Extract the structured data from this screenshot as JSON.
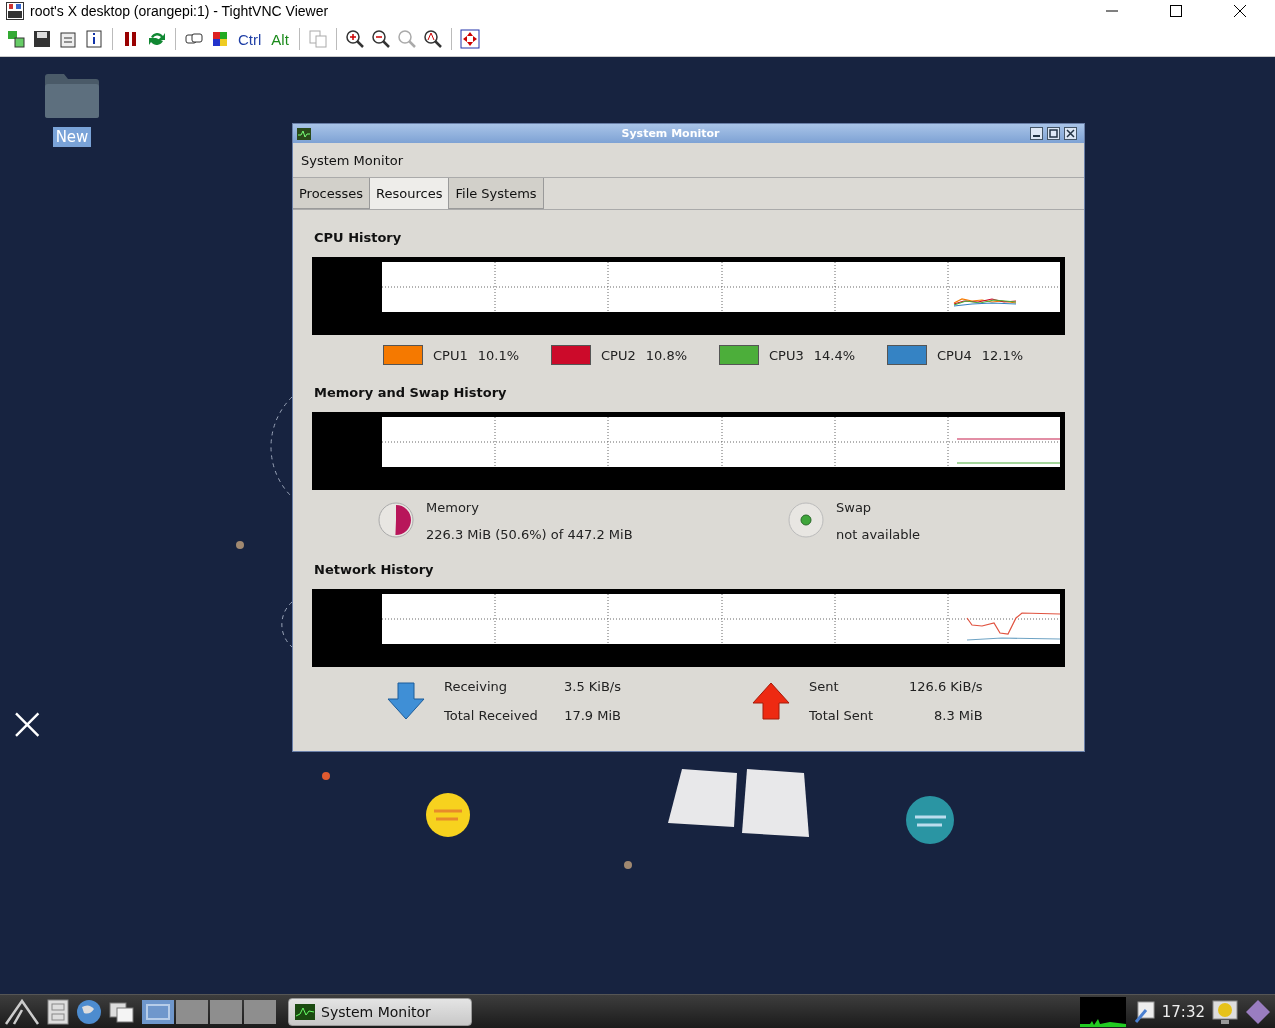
{
  "window": {
    "title": "root's X desktop (orangepi:1) - TightVNC Viewer"
  },
  "toolbar": {
    "keys": [
      "Ctrl",
      "Alt"
    ]
  },
  "desktop": {
    "icons": [
      {
        "label": "New",
        "selected": true
      }
    ]
  },
  "system_monitor": {
    "title": "System Monitor",
    "menu": "System Monitor",
    "tabs": [
      {
        "label": "Processes",
        "selected": false
      },
      {
        "label": "Resources",
        "selected": true
      },
      {
        "label": "File Systems",
        "selected": false
      }
    ],
    "cpu": {
      "heading": "CPU History",
      "legend": [
        {
          "name": "CPU1",
          "value": "10.1%",
          "color": "#f57900"
        },
        {
          "name": "CPU2",
          "value": "10.8%",
          "color": "#cc0a2a"
        },
        {
          "name": "CPU3",
          "value": "14.4%",
          "color": "#4cae3a"
        },
        {
          "name": "CPU4",
          "value": "12.1%",
          "color": "#3583c4"
        }
      ]
    },
    "memory": {
      "heading": "Memory and Swap History",
      "items": [
        {
          "kind": "pie",
          "label": "Memory",
          "value": "226.3 MiB (50.6%) of 447.2 MiB",
          "level": 0.506
        },
        {
          "kind": "none",
          "label": "Swap",
          "value": "not available"
        }
      ]
    },
    "network": {
      "heading": "Network History",
      "items": [
        {
          "kind": "down",
          "label": "Receiving",
          "rate": "3.5 KiB/s",
          "total_label": "Total Received",
          "total": "17.9 MiB"
        },
        {
          "kind": "up",
          "label": "Sent",
          "rate": "126.6 KiB/s",
          "total_label": "Total Sent",
          "total": "8.3 MiB"
        }
      ]
    }
  },
  "taskbar": {
    "workspaces": [
      {
        "selected": true
      },
      {
        "selected": false
      },
      {
        "selected": false
      },
      {
        "selected": false
      }
    ],
    "tasks": [
      {
        "label": "System Monitor"
      }
    ],
    "clock": "17:32"
  }
}
